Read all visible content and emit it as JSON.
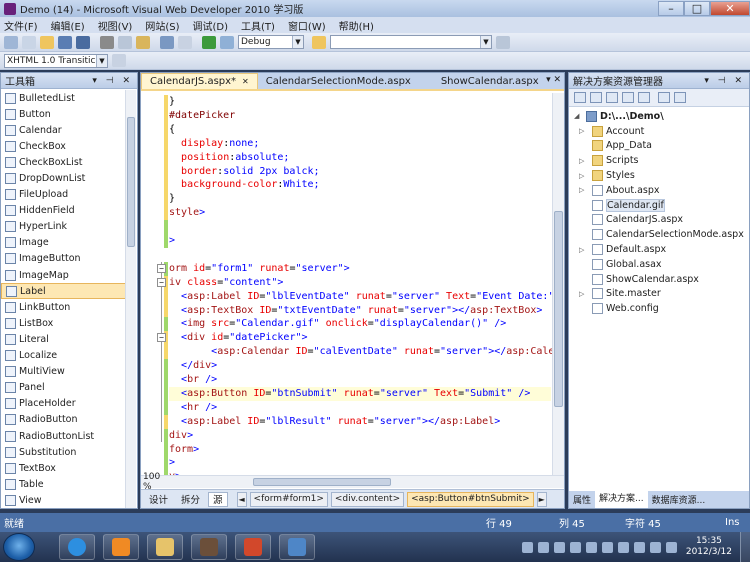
{
  "window": {
    "title": "Demo (14) - Microsoft Visual Web Developer 2010 学习版",
    "controls": [
      "–",
      "□",
      "✕"
    ]
  },
  "menu": [
    "文件(F)",
    "编辑(E)",
    "视图(V)",
    "网站(S)",
    "调试(D)",
    "工具(T)",
    "窗口(W)",
    "帮助(H)"
  ],
  "toolbar": {
    "config_value": "Debug",
    "search_value": "",
    "doctype_value": "XHTML 1.0 Transitic"
  },
  "toolbox": {
    "title": "工具箱",
    "items": [
      "BulletedList",
      "Button",
      "Calendar",
      "CheckBox",
      "CheckBoxList",
      "DropDownList",
      "FileUpload",
      "HiddenField",
      "HyperLink",
      "Image",
      "ImageButton",
      "ImageMap",
      "Label",
      "LinkButton",
      "ListBox",
      "Literal",
      "Localize",
      "MultiView",
      "Panel",
      "PlaceHolder",
      "RadioButton",
      "RadioButtonList",
      "Substitution",
      "TextBox",
      "Table",
      "View"
    ],
    "selected": "Label"
  },
  "editor": {
    "tabs": [
      "CalendarJS.aspx*",
      "CalendarSelectionMode.aspx",
      "ShowCalendar.aspx"
    ],
    "active_tab": "CalendarJS.aspx*",
    "lines": [
      "}",
      "#datePicker",
      "{",
      "  display:none;",
      "  position:absolute;",
      "  border:solid 2px balck;",
      "  background-color:White;",
      "}",
      "style>",
      "",
      ">",
      "",
      "orm id=\"form1\" runat=\"server\">",
      "iv class=\"content\">",
      "  <asp:Label ID=\"lblEventDate\" runat=\"server\" Text=\"Event Date:\" A",
      "  <asp:TextBox ID=\"txtEventDate\" runat=\"server\"></asp:TextBox>",
      "  <img src=\"Calendar.gif\" onclick=\"displayCalendar()\" />",
      "  <div id=\"datePicker\">",
      "       <asp:Calendar ID=\"calEventDate\" runat=\"server\"></asp:Calenda",
      "  </div>",
      "  <br />",
      "  <asp:Button ID=\"btnSubmit\" runat=\"server\" Text=\"Submit\" />",
      "  <hr />",
      "  <asp:Label ID=\"lblResult\" runat=\"server\"></asp:Label>",
      "div>",
      "form>",
      ">",
      "y>"
    ],
    "zoom": "100 %",
    "views": [
      "设计",
      "拆分",
      "源"
    ],
    "active_view": "源",
    "breadcrumbs": [
      "<form#form1>",
      "<div.content>",
      "<asp:Button#btnSubmit>"
    ]
  },
  "solution": {
    "title": "解决方案资源管理器",
    "root": "D:\\...\\Demo\\",
    "items": [
      {
        "name": "Account",
        "type": "folder",
        "expandable": true
      },
      {
        "name": "App_Data",
        "type": "folder",
        "expandable": false
      },
      {
        "name": "Scripts",
        "type": "folder",
        "expandable": true
      },
      {
        "name": "Styles",
        "type": "folder",
        "expandable": true
      },
      {
        "name": "About.aspx",
        "type": "file",
        "expandable": true
      },
      {
        "name": "Calendar.gif",
        "type": "file",
        "expandable": false
      },
      {
        "name": "CalendarJS.aspx",
        "type": "file",
        "expandable": false
      },
      {
        "name": "CalendarSelectionMode.aspx",
        "type": "file",
        "expandable": false
      },
      {
        "name": "Default.aspx",
        "type": "file",
        "expandable": true
      },
      {
        "name": "Global.asax",
        "type": "file",
        "expandable": false
      },
      {
        "name": "ShowCalendar.aspx",
        "type": "file",
        "expandable": false
      },
      {
        "name": "Site.master",
        "type": "file",
        "expandable": true
      },
      {
        "name": "Web.config",
        "type": "file",
        "expandable": false
      }
    ],
    "bottom_tabs": [
      "属性",
      "解决方案...",
      "数据库资源..."
    ]
  },
  "status": {
    "text": "就绪",
    "line": "行 49",
    "col": "列 45",
    "char": "字符 45",
    "mode": "Ins"
  },
  "taskbar": {
    "time": "15:35",
    "date": "2012/3/12"
  },
  "colors": {
    "accent": "#4a6fa5",
    "selection": "#fde7b3",
    "keyword": "#0000ff",
    "attribute": "#e80000",
    "element": "#a31515"
  }
}
